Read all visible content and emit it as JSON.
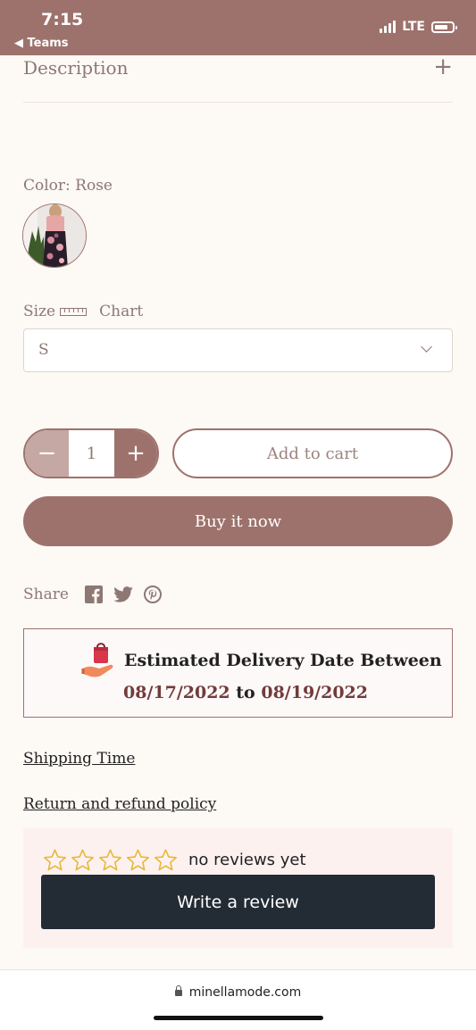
{
  "status_bar": {
    "time": "7:15",
    "back_label": "◀ Teams",
    "network": "LTE"
  },
  "description": {
    "label": "Description",
    "toggle": "+"
  },
  "color": {
    "label": "Color: Rose"
  },
  "size": {
    "label": "Size",
    "chart_label": "Chart",
    "selected": "S"
  },
  "quantity": {
    "minus": "−",
    "value": "1",
    "plus": "+"
  },
  "buttons": {
    "add_to_cart": "Add to cart",
    "buy_now": "Buy it now"
  },
  "share": {
    "label": "Share",
    "icons": [
      "facebook-icon",
      "twitter-icon",
      "pinterest-icon"
    ]
  },
  "delivery": {
    "title": "Estimated Delivery Date Between",
    "date_from": "08/17/2022",
    "connector": "to",
    "date_to": "08/19/2022"
  },
  "links": {
    "shipping": "Shipping Time",
    "return_policy": "Return and refund policy"
  },
  "reviews": {
    "star_count": 5,
    "status": "no reviews yet",
    "write_button": "Write a review"
  },
  "browser": {
    "url": "minellamode.com"
  },
  "colors": {
    "brand": "#9e726c",
    "brand_light": "#c5a8a4",
    "background": "#fdf9f5",
    "review_button": "#232b35",
    "date_color": "#733b3b"
  }
}
